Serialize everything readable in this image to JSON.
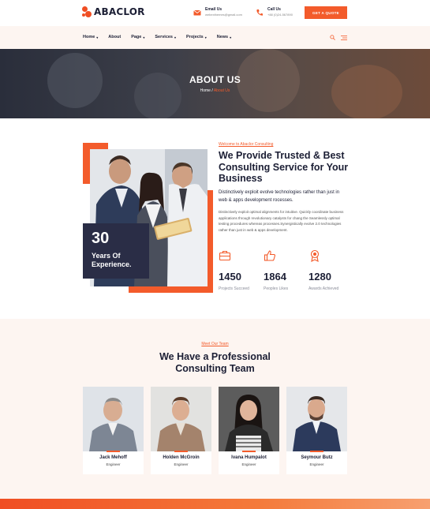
{
  "brand": {
    "name": "ABACLOR",
    "accent": "#f35b2b",
    "dark": "#1c1f35"
  },
  "header": {
    "email_label": "Email Us",
    "email_value": "webexthemes@gmail.com",
    "call_label": "Call Us",
    "call_value": "+88 (0)24-567890",
    "quote_button": "GET A QUOTE"
  },
  "nav": {
    "items": [
      {
        "label": "Home",
        "has_dropdown": true
      },
      {
        "label": "About",
        "has_dropdown": false
      },
      {
        "label": "Page",
        "has_dropdown": true
      },
      {
        "label": "Services",
        "has_dropdown": true
      },
      {
        "label": "Projects",
        "has_dropdown": true
      },
      {
        "label": "News",
        "has_dropdown": true
      }
    ],
    "icons": [
      "search-icon",
      "menu-icon"
    ]
  },
  "hero": {
    "title": "ABOUT US",
    "breadcrumb_home": "Home",
    "breadcrumb_sep": "/",
    "breadcrumb_current": "About Us"
  },
  "about": {
    "tag": "Welcome to Abaclor Consulting",
    "heading": "We Provide Trusted & Best Consulting Service for Your Business",
    "lead": "Distinctively exploit evolve technologies rather than just in web & apps development rocesses.",
    "paragraph": "Distinctively exploit optimal alignments for intuitive. Quickly coordinate business applications through revolutionary catalysts for chang the Seamlessly optimal testing procedures whereas processes.Synergistically evolve 2.0 technologies rather than just in web & apps development.",
    "experience_number": "30",
    "experience_label": "Years Of Experience."
  },
  "stats": [
    {
      "icon": "briefcase-icon",
      "value": "1450",
      "label": "Projects Succeed"
    },
    {
      "icon": "thumbs-up-icon",
      "value": "1864",
      "label": "Peoples Likes"
    },
    {
      "icon": "award-icon",
      "value": "1280",
      "label": "Awards Achieved"
    }
  ],
  "team": {
    "tag": "Meet Our Team",
    "heading": "We Have a Professional Consulting Team",
    "members": [
      {
        "name": "Jack Mehoff",
        "role": "Engineer"
      },
      {
        "name": "Holden McGroin",
        "role": "Engineer"
      },
      {
        "name": "Ivana Humpalot",
        "role": "Engineer"
      },
      {
        "name": "Seymour Butz",
        "role": "Engineer"
      }
    ]
  }
}
